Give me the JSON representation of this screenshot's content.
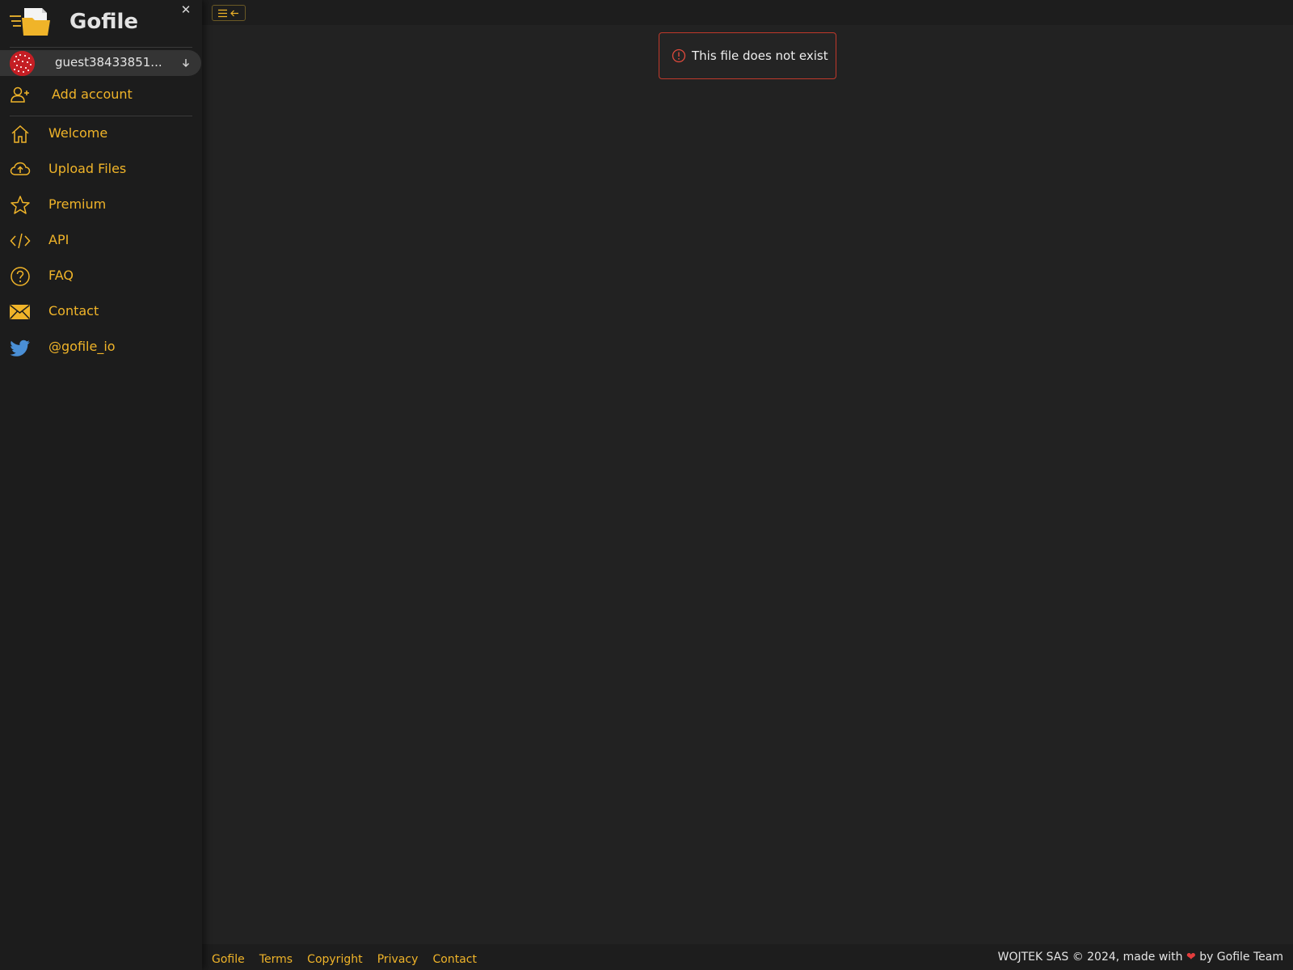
{
  "brand": {
    "name": "Gofile"
  },
  "account": {
    "username": "guest38433851..."
  },
  "sidebar": {
    "add_account": {
      "label": "Add account",
      "icon": "add-user-icon"
    },
    "items": [
      {
        "label": "Welcome",
        "icon": "home-icon"
      },
      {
        "label": "Upload Files",
        "icon": "cloud-upload-icon"
      },
      {
        "label": "Premium",
        "icon": "star-icon"
      },
      {
        "label": "API",
        "icon": "code-icon"
      },
      {
        "label": "FAQ",
        "icon": "question-icon"
      },
      {
        "label": "Contact",
        "icon": "envelope-icon"
      },
      {
        "label": "@gofile_io",
        "icon": "twitter-icon"
      }
    ]
  },
  "alert": {
    "message": "This file does not exist"
  },
  "footer": {
    "links": [
      "Gofile",
      "Terms",
      "Copyright",
      "Privacy",
      "Contact"
    ],
    "copyright_prefix": "WOJTEK SAS © 2024, made with",
    "copyright_suffix": "by Gofile Team"
  },
  "colors": {
    "accent": "#f0b429",
    "background": "#222222",
    "sidebar": "#1c1c1c",
    "error": "#c0392b",
    "twitter": "#4a8fd6"
  }
}
